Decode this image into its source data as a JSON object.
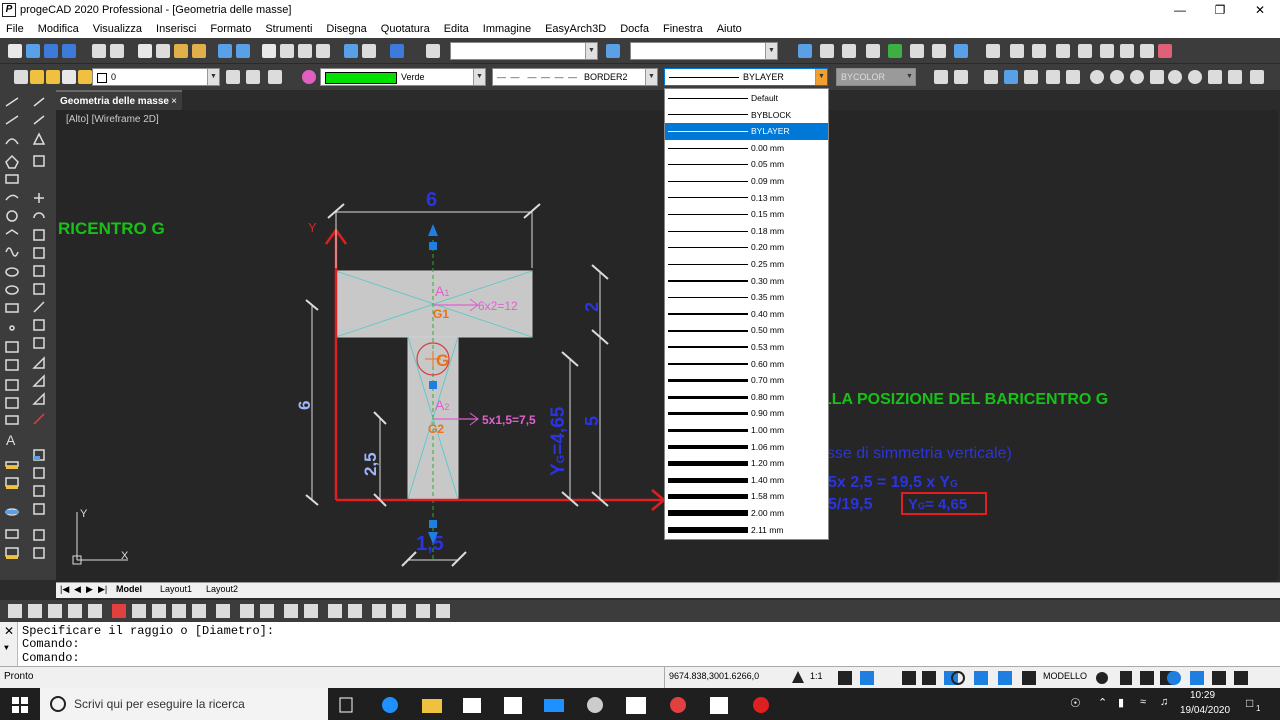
{
  "window": {
    "title": "progeCAD 2020 Professional - [Geometria delle masse]",
    "app_icon": "P"
  },
  "menu": [
    "File",
    "Modifica",
    "Visualizza",
    "Inserisci",
    "Formato",
    "Strumenti",
    "Disegna",
    "Quotatura",
    "Edita",
    "Immagine",
    "EasyArch3D",
    "Docfa",
    "Finestra",
    "Aiuto"
  ],
  "properties": {
    "layer": "0",
    "color_name": "Verde",
    "color_hex": "#00e000",
    "linetype": "BORDER2",
    "lineweight": "BYLAYER",
    "plotstyle": "BYCOLOR"
  },
  "lineweight_options": [
    {
      "label": "Default",
      "w": 1
    },
    {
      "label": "BYBLOCK",
      "w": 1
    },
    {
      "label": "BYLAYER",
      "w": 1
    },
    {
      "label": "0.00 mm",
      "w": 1
    },
    {
      "label": "0.05 mm",
      "w": 1
    },
    {
      "label": "0.09 mm",
      "w": 1
    },
    {
      "label": "0.13 mm",
      "w": 1
    },
    {
      "label": "0.15 mm",
      "w": 1
    },
    {
      "label": "0.18 mm",
      "w": 1
    },
    {
      "label": "0.20 mm",
      "w": 1
    },
    {
      "label": "0.25 mm",
      "w": 1
    },
    {
      "label": "0.30 mm",
      "w": 1.5
    },
    {
      "label": "0.35 mm",
      "w": 1.5
    },
    {
      "label": "0.40 mm",
      "w": 1.5
    },
    {
      "label": "0.50 mm",
      "w": 2
    },
    {
      "label": "0.53 mm",
      "w": 2
    },
    {
      "label": "0.60 mm",
      "w": 2.5
    },
    {
      "label": "0.70 mm",
      "w": 2.5
    },
    {
      "label": "0.80 mm",
      "w": 3
    },
    {
      "label": "0.90 mm",
      "w": 3
    },
    {
      "label": "1.00 mm",
      "w": 3.5
    },
    {
      "label": "1.06 mm",
      "w": 4
    },
    {
      "label": "1.20 mm",
      "w": 4.5
    },
    {
      "label": "1.40 mm",
      "w": 5
    },
    {
      "label": "1.58 mm",
      "w": 5.5
    },
    {
      "label": "2.00 mm",
      "w": 6
    },
    {
      "label": "2.11 mm",
      "w": 6.5
    }
  ],
  "lineweight_selected": "BYLAYER",
  "doc_tab": {
    "label": "Geometria delle masse",
    "close": "×"
  },
  "view_label": "[Alto] [Wireframe 2D]",
  "drawing": {
    "title_partial": "RICENTRO G",
    "heading_partial": "LLA POSIZIONE DEL BARICENTRO G",
    "note_partial": "asse di simmetria verticale)",
    "eq_partial": "5x 2,5 = 19,5 x Y",
    "eq_sub": "G",
    "eq2_partial": "5/19,5",
    "result_box": "Y",
    "result_sub": "G",
    "result_value": "= 4,65",
    "dim_top": "6",
    "dim_left": "6",
    "dim_right_top": "2",
    "dim_right_mid": "5",
    "dim_bottom_small": "2,5",
    "dim_bottom": "1,5",
    "yg_label": "Y",
    "yg_sub": "G",
    "yg_value": "=4,65",
    "a1": "A",
    "a1_sub": "1",
    "g1": "G1",
    "a1_calc": "6x2=12",
    "a2": "A",
    "a2_sub": "2",
    "g2": "G2",
    "a2_calc": "5x1,5=7,5",
    "g": "G",
    "axis_y": "Y",
    "ucs_y": "Y",
    "ucs_x": "X"
  },
  "layout_tabs": [
    "Model",
    "Layout1",
    "Layout2"
  ],
  "command_lines": [
    "Specificare il raggio o [Diametro]:",
    "Comando:",
    "Comando:"
  ],
  "status": {
    "left": "Pronto",
    "coords": "9674.838,3001.6266,0",
    "scale": "1:1",
    "mode": "MODELLO"
  },
  "taskbar": {
    "search_placeholder": "Scrivi qui per eseguire la ricerca",
    "time": "10:29",
    "date": "19/04/2020",
    "notif": "1"
  }
}
